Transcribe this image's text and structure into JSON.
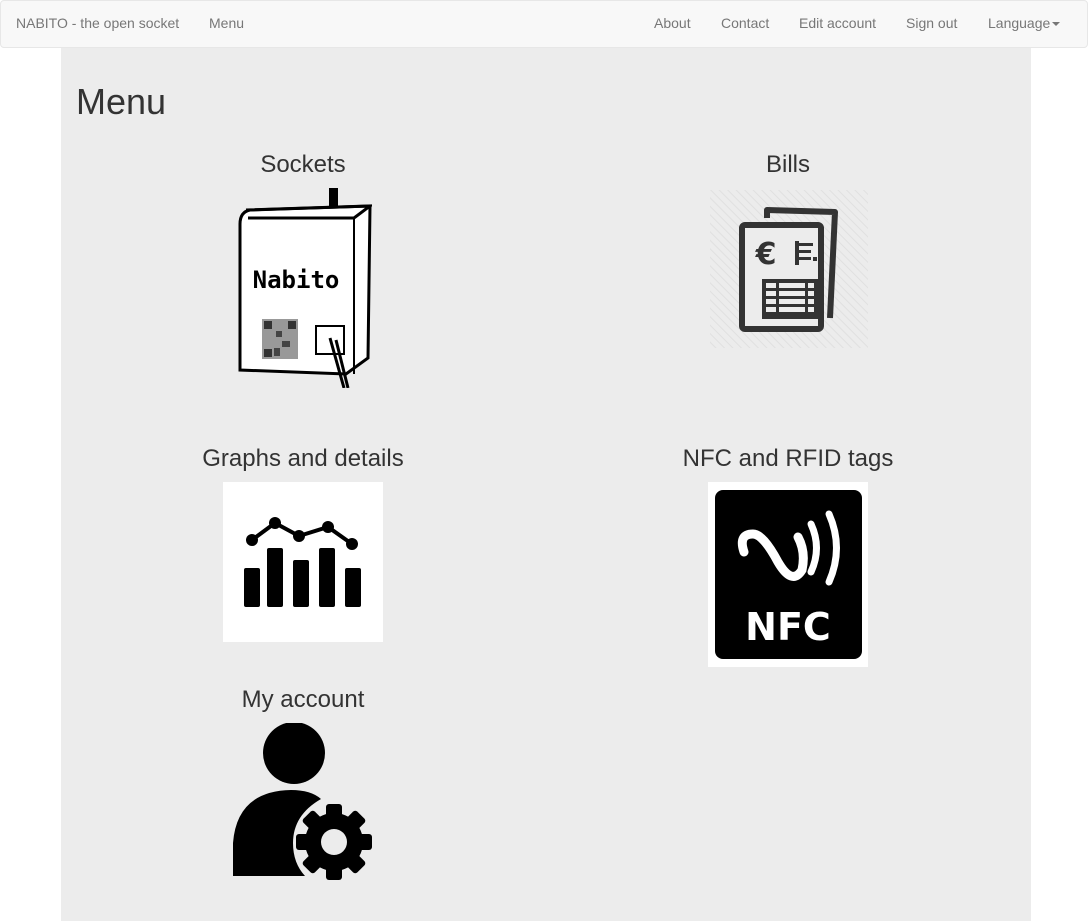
{
  "navbar": {
    "brand": "NABITO - the open socket",
    "left_items": [
      {
        "label": "Menu"
      }
    ],
    "right_items": [
      {
        "label": "About"
      },
      {
        "label": "Contact"
      },
      {
        "label": "Edit account"
      },
      {
        "label": "Sign out"
      },
      {
        "label": "Language",
        "dropdown": true
      }
    ]
  },
  "page": {
    "title": "Menu",
    "tiles": [
      {
        "title": "Sockets",
        "icon": "socket-device-icon",
        "icon_text": "Nabito"
      },
      {
        "title": "Bills",
        "icon": "bills-euro-icon",
        "icon_text": "€"
      },
      {
        "title": "Graphs and details",
        "icon": "chart-icon"
      },
      {
        "title": "NFC and RFID tags",
        "icon": "nfc-icon",
        "icon_text": "NFC"
      },
      {
        "title": "My account",
        "icon": "user-settings-icon"
      }
    ]
  },
  "colors": {
    "navbar_bg": "#f8f8f8",
    "nav_text": "#777777",
    "container_bg": "#ececec",
    "heading_text": "#333333"
  }
}
